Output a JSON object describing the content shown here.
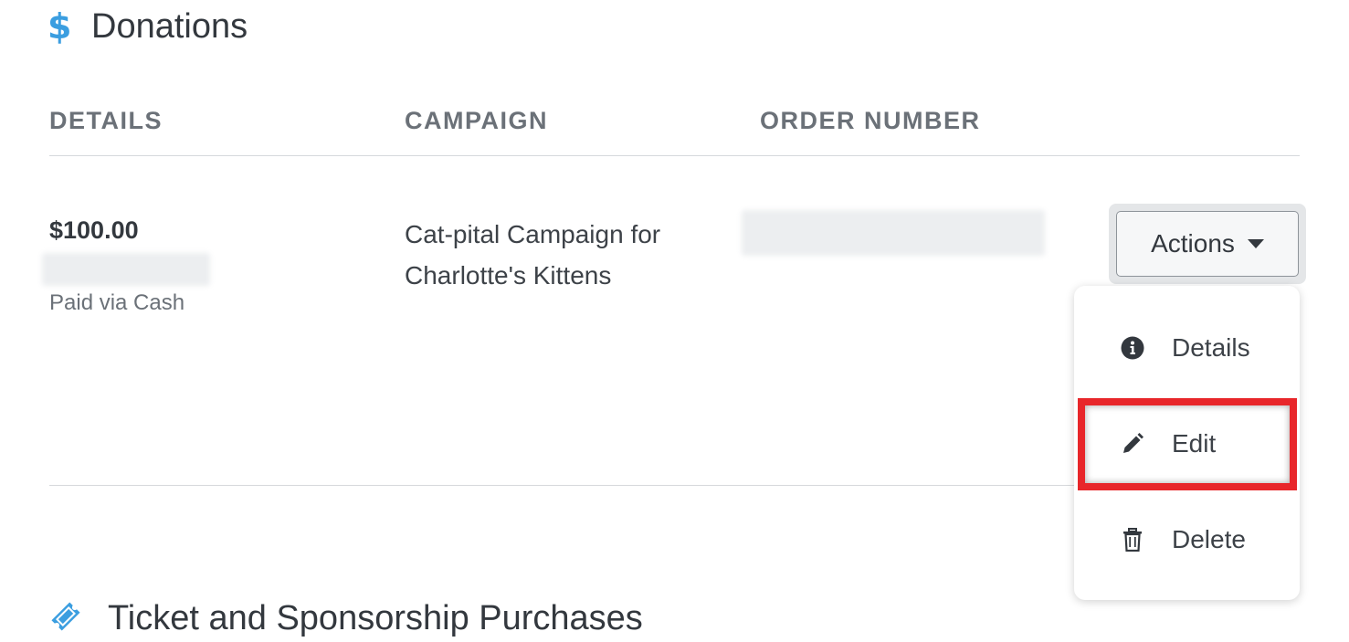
{
  "donations": {
    "title": "Donations",
    "icon": "dollar-icon",
    "icon_glyph": "$",
    "accent_color": "#3b9ee0",
    "columns": [
      "DETAILS",
      "CAMPAIGN",
      "ORDER NUMBER"
    ],
    "row": {
      "amount": "$100.00",
      "payment_method": "Paid via Cash",
      "campaign": "Cat-pital Campaign for Charlotte's Kittens"
    },
    "actions": {
      "button_label": "Actions",
      "menu": [
        {
          "label": "Details",
          "icon": "info-circle-icon"
        },
        {
          "label": "Edit",
          "icon": "pencil-icon"
        },
        {
          "label": "Delete",
          "icon": "trash-icon"
        }
      ],
      "highlighted_item": "Edit",
      "highlight_color": "#e8262a"
    }
  },
  "tickets": {
    "title": "Ticket and Sponsorship Purchases",
    "icon": "ticket-icon"
  }
}
